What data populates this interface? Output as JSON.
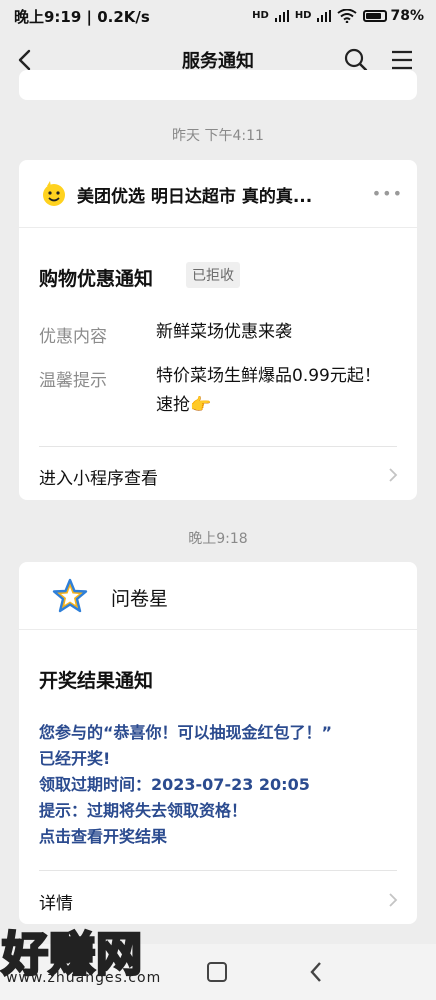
{
  "status_bar": {
    "left_text": "晚上9:19 | 0.2K/s",
    "signal_1": "HD",
    "signal_2": "HD",
    "battery": "78%",
    "battery_level": 0.78
  },
  "nav": {
    "title": "服务通知",
    "back_icon": "chevron-left-icon",
    "search_icon": "search-icon",
    "menu_icon": "menu-icon"
  },
  "timestamps": {
    "first": "昨天 下午4:11",
    "second": "晚上9:18"
  },
  "card1": {
    "app_name": "美团优选 明日达超市 真的真...",
    "more": "•••",
    "notice_title": "购物优惠通知",
    "status_badge": "已拒收",
    "rows": [
      {
        "key": "优惠内容",
        "value": "新鲜菜场优惠来袭"
      },
      {
        "key": "温馨提示",
        "value": "特价菜场生鲜爆品0.99元起！速抢👉"
      }
    ],
    "footer_link": "进入小程序查看"
  },
  "card2": {
    "app_name": "问卷星",
    "notice_title": "开奖结果通知",
    "lines": [
      "您参与的“恭喜你！可以抽现金红包了！”",
      "已经开奖!",
      "领取过期时间：2023-07-23 20:05",
      "提示：过期将失去领取资格！",
      "点击查看开奖结果"
    ],
    "footer_link": "详情"
  },
  "watermark": {
    "big": "好赚网",
    "small": "www.zhuanges.com"
  },
  "colors": {
    "background": "#ededed",
    "card": "#ffffff",
    "prize_text": "#2b4b8f"
  }
}
